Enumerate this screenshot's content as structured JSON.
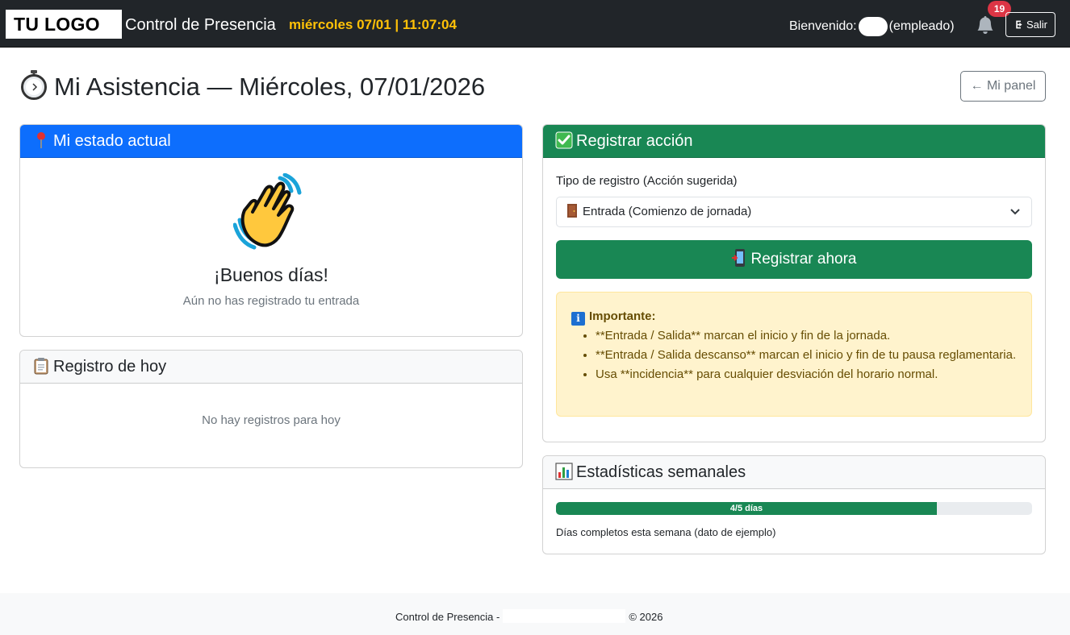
{
  "navbar": {
    "logo": "TU LOGO",
    "brand": "Control de Presencia",
    "clock": "miércoles 07/01 | 11:07:04",
    "welcome_prefix": "Bienvenido:",
    "role": "(empleado)",
    "notifications_count": "19",
    "logout_label": "Salir"
  },
  "page": {
    "title": "Mi Asistencia — Miércoles, 07/01/2026",
    "back_button": "← Mi panel"
  },
  "status_card": {
    "header": "Mi estado actual",
    "greeting": "¡Buenos días!",
    "subtitle": "Aún no has registrado tu entrada"
  },
  "today_card": {
    "header": "Registro de hoy",
    "empty_message": "No hay registros para hoy"
  },
  "register_card": {
    "header": "Registrar acción",
    "field_label": "Tipo de registro (Acción sugerida)",
    "selected_option": "Entrada (Comienzo de jornada)",
    "submit_label": "Registrar ahora",
    "alert_title": "Importante:",
    "alert_items": [
      "**Entrada / Salida** marcan el inicio y fin de la jornada.",
      "**Entrada / Salida descanso** marcan el inicio y fin de tu pausa reglamentaria.",
      "Usa **incidencia** para cualquier desviación del horario normal."
    ]
  },
  "stats_card": {
    "header": "Estadísticas semanales",
    "progress_label": "4/5 días",
    "progress_fraction": 0.8,
    "note": "Días completos esta semana (dato de ejemplo)"
  },
  "footer": {
    "prefix": "Control de Presencia -",
    "suffix": "© 2026"
  },
  "colors": {
    "navbar": "#212529",
    "clock": "#ffc107",
    "primary": "#0d6efd",
    "success": "#198754",
    "danger": "#dc3545",
    "warning_bg": "#fff3cd"
  }
}
